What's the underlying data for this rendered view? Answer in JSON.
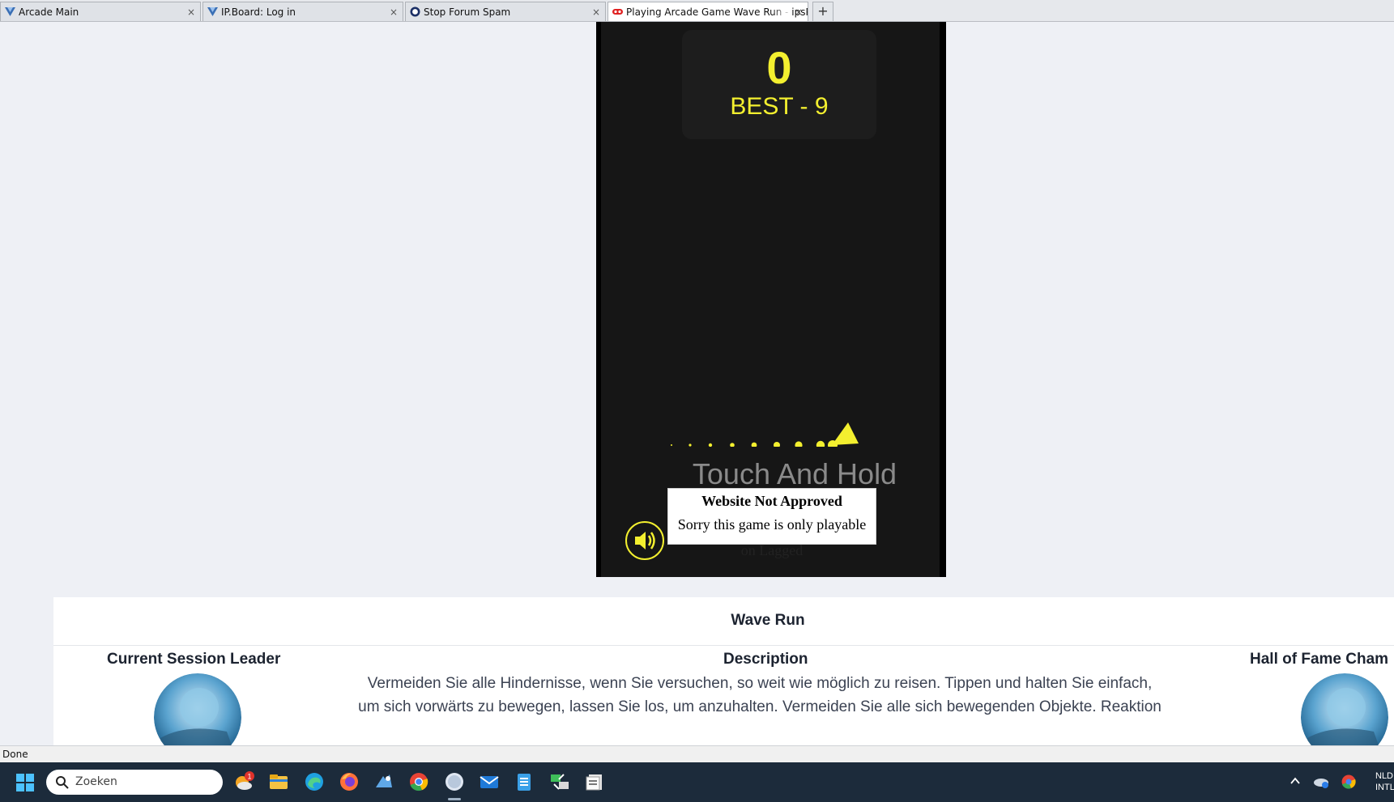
{
  "browser": {
    "tabs": [
      {
        "title": "Arcade Main",
        "close": "×"
      },
      {
        "title": "IP.Board: Log in",
        "close": "×"
      },
      {
        "title": "Stop Forum Spam",
        "close": "×"
      },
      {
        "title": "Playing Arcade Game Wave Run - ipsPr",
        "close": "×"
      }
    ],
    "new_tab": "+",
    "status": "Done"
  },
  "game": {
    "score": "0",
    "best": "BEST - 9",
    "prompt": "Touch And Hold",
    "accent": "#f3ef2f",
    "notice": {
      "title": "Website Not Approved",
      "message": "Sorry this game is only playable",
      "overflow": "on Lagged"
    }
  },
  "info": {
    "title": "Wave Run",
    "leader_heading": "Current Session Leader",
    "description_heading": "Description",
    "hof_heading": "Hall of Fame Cham",
    "description_line1": "Vermeiden Sie alle Hindernisse, wenn Sie versuchen, so weit wie möglich zu reisen. Tippen und halten Sie einfach,",
    "description_line2": "um sich vorwärts zu bewegen, lassen Sie los, um anzuhalten. Vermeiden Sie alle sich bewegenden Objekte. Reaktion"
  },
  "taskbar": {
    "search_placeholder": "Zoeken",
    "badge": "1",
    "tray_lang": "NLD",
    "tray_layout": "INTL"
  }
}
